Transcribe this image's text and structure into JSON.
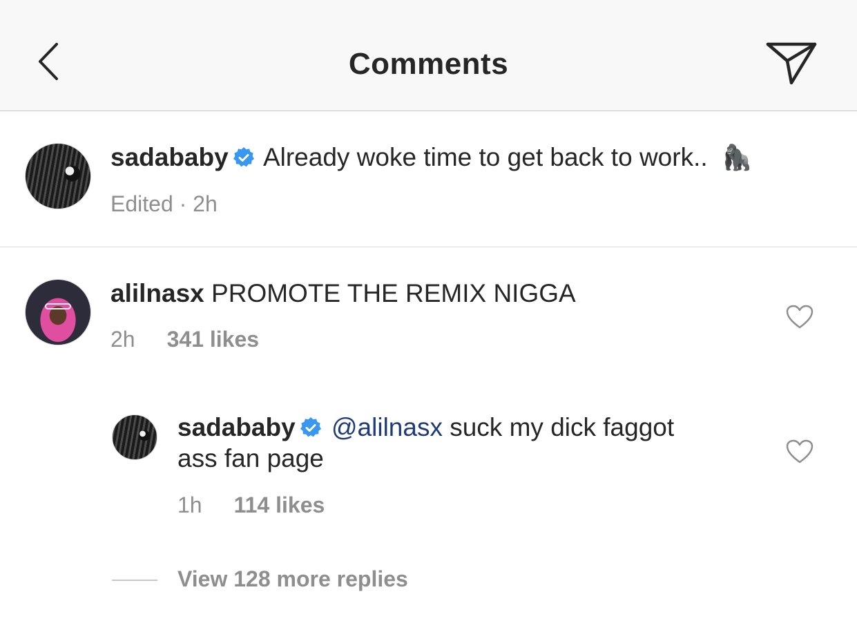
{
  "header": {
    "title": "Comments"
  },
  "caption": {
    "username": "sadababy",
    "text": "Already woke time to get back to work..",
    "emoji": "🦍",
    "meta": "Edited · 2h"
  },
  "comments": [
    {
      "username": "alilnasx",
      "text": "PROMOTE THE REMIX NIGGA",
      "time": "2h",
      "likes": "341 likes"
    }
  ],
  "replies": [
    {
      "username": "sadababy",
      "mention": "@alilnasx",
      "text_line1": "suck my dick faggot",
      "text_line2": "ass fan page",
      "time": "1h",
      "likes": "114 likes"
    }
  ],
  "view_replies": {
    "label": "View 128 more replies"
  },
  "colors": {
    "verified": "#3897f0",
    "mention": "#1f3a7a",
    "meta": "#8e8e8e",
    "header_bg": "#f8f8f8"
  },
  "icons": [
    "chevron-left-icon",
    "send-icon",
    "verified-badge-icon",
    "heart-icon"
  ]
}
